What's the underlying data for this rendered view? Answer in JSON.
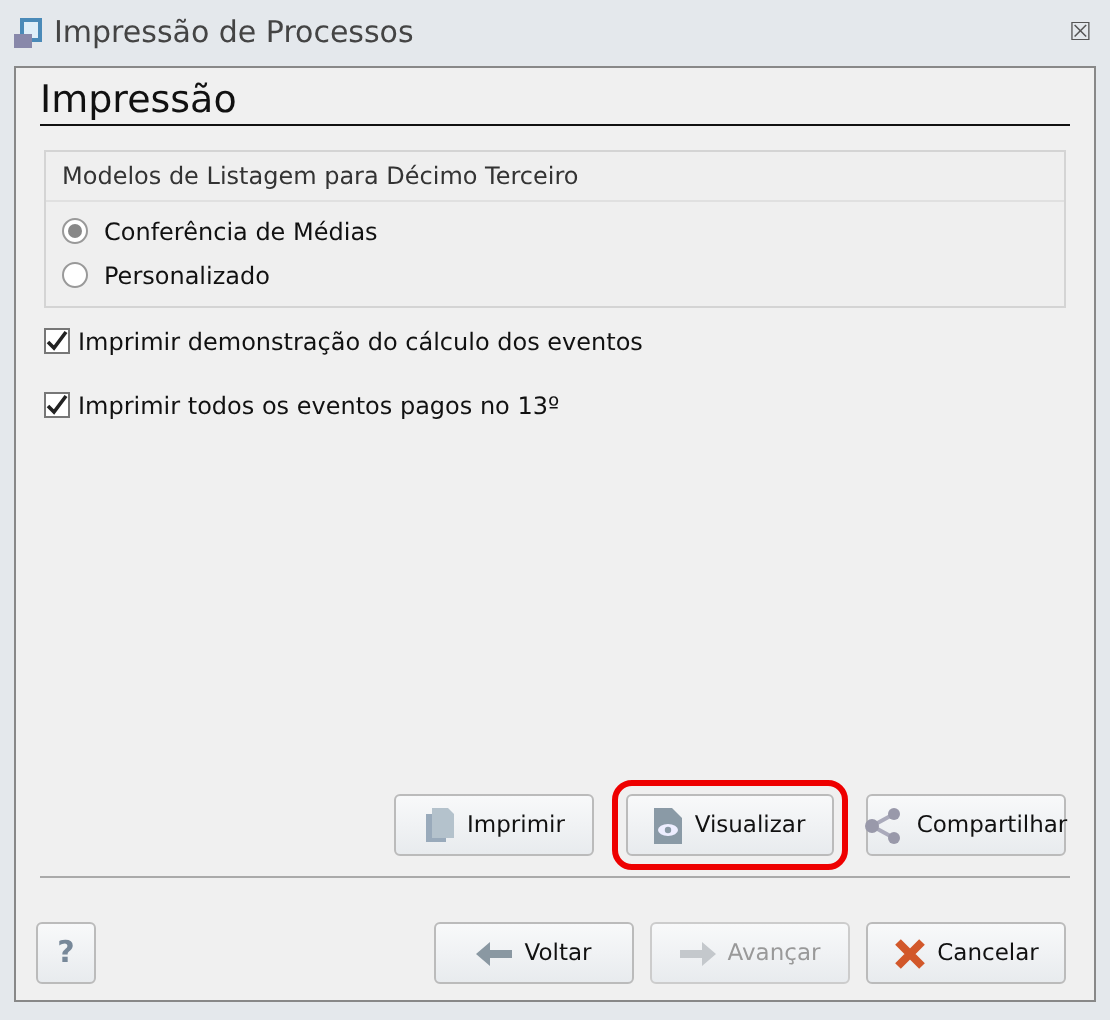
{
  "window": {
    "title": "Impressão de Processos",
    "close": "⮽"
  },
  "heading": "Impressão",
  "group": {
    "title": "Modelos de Listagem para Décimo Terceiro",
    "options": [
      {
        "label": "Conferência de Médias",
        "selected": true
      },
      {
        "label": "Personalizado",
        "selected": false
      }
    ]
  },
  "checks": [
    {
      "label": "Imprimir demonstração do cálculo dos eventos",
      "checked": true
    },
    {
      "label": "Imprimir todos os eventos pagos no 13º",
      "checked": true
    }
  ],
  "actions": [
    {
      "kind": "print",
      "label": "Imprimir",
      "highlighted": false
    },
    {
      "kind": "preview",
      "label": "Visualizar",
      "highlighted": true
    },
    {
      "kind": "share",
      "label": "Compartilhar",
      "highlighted": false
    }
  ],
  "help": "?",
  "nav": [
    {
      "kind": "back",
      "label": "Voltar",
      "disabled": false
    },
    {
      "kind": "next",
      "label": "Avançar",
      "disabled": true
    },
    {
      "kind": "cancel",
      "label": "Cancelar",
      "disabled": false
    }
  ]
}
